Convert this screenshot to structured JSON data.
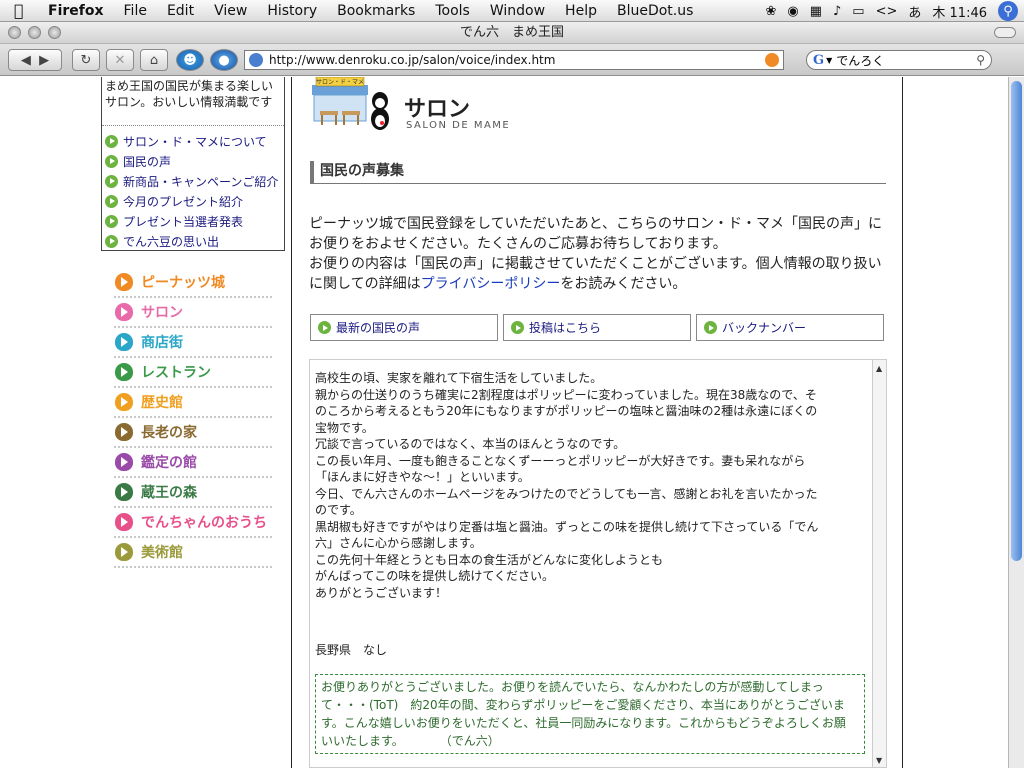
{
  "menubar": {
    "app": "Firefox",
    "items": [
      "File",
      "Edit",
      "View",
      "History",
      "Bookmarks",
      "Tools",
      "Window",
      "Help",
      "BlueDot.us"
    ],
    "input_method": "あ",
    "clock": "木 11:46"
  },
  "window": {
    "title": "でん六　まめ王国"
  },
  "toolbar": {
    "url": "http://www.denroku.co.jp/salon/voice/index.htm",
    "search_value": "でんろく"
  },
  "sidebar": {
    "intro_text": "まめ王国の国民が集まる楽しいサロン。おいしい情報満載です",
    "links": [
      "サロン・ド・マメについて",
      "国民の声",
      "新商品・キャンペーンご紹介",
      "今月のプレゼント紹介",
      "プレゼント当選者発表",
      "でん六豆の思い出"
    ],
    "categories": [
      {
        "label": "ピーナッツ城",
        "color": "#f08a24"
      },
      {
        "label": "サロン",
        "color": "#e86aa8"
      },
      {
        "label": "商店街",
        "color": "#2aa6c8"
      },
      {
        "label": "レストラン",
        "color": "#3a9a4a"
      },
      {
        "label": "歴史館",
        "color": "#f0a020"
      },
      {
        "label": "長老の家",
        "color": "#8a6a30"
      },
      {
        "label": "鑑定の館",
        "color": "#9a4aa8"
      },
      {
        "label": "蔵王の森",
        "color": "#3a7a44"
      },
      {
        "label": "でんちゃんのおうち",
        "color": "#e8508a"
      },
      {
        "label": "美術館",
        "color": "#9a9a3a"
      }
    ]
  },
  "main": {
    "logo_sign": "サロン・ド・マメ",
    "title": "サロン",
    "subtitle": "SALON DE MAME",
    "section_heading": "国民の声募集",
    "intro": {
      "line1": "ピーナッツ城で国民登録をしていただいたあと、こちらのサロン・ド・マメ「国民の声」に",
      "line2": "お便りをおよせください。たくさんのご応募お待ちしております。",
      "line3": "お便りの内容は「国民の声」に掲載させていただくことがございます。個人情報の取り扱い",
      "line4_before": "に関しての詳細は",
      "line4_link": "プライバシーポリシー",
      "line4_after": "をお読みください。"
    },
    "tabs": [
      "最新の国民の声",
      "投稿はこちら",
      "バックナンバー"
    ],
    "letter": {
      "lines": [
        "高校生の頃、実家を離れて下宿生活をしていました。",
        "親からの仕送りのうち確実に2割程度はポリッピーに変わっていました。現在38歳なので、そ",
        "のころから考えるともう20年にもなりますがポリッピーの塩味と醤油味の2種は永遠にぼくの",
        "宝物です。",
        "冗談で言っているのではなく、本当のほんとうなのです。",
        "この長い年月、一度も飽きることなくずーーっとポリッピーが大好きです。妻も呆れながら",
        "「ほんまに好きやな～！」といいます。",
        "今日、でん六さんのホームページをみつけたのでどうしても一言、感謝とお礼を言いたかった",
        "のです。",
        "黒胡椒も好きですがやはり定番は塩と醤油。ずっとこの味を提供し続けて下さっている「でん",
        "六」さんに心から感謝します。",
        "この先何十年経とうとも日本の食生活がどんなに変化しようとも",
        "がんばってこの味を提供し続けてください。",
        "ありがとうございます！"
      ],
      "author": "長野県　なし"
    },
    "reply": {
      "lines": [
        "お便りありがとうございました。お便りを読んでいたら、なんかわたしの方が感動してしまっ",
        "て・・・(ToT)　約20年の間、変わらずポリッピーをご愛顧くださり、本当にありがとうございま",
        "す。こんな嬉しいお便りをいただくと、社員一同励みになります。これからもどうぞよろしくお願",
        "いいたします。　　　　（でん六）"
      ]
    }
  }
}
